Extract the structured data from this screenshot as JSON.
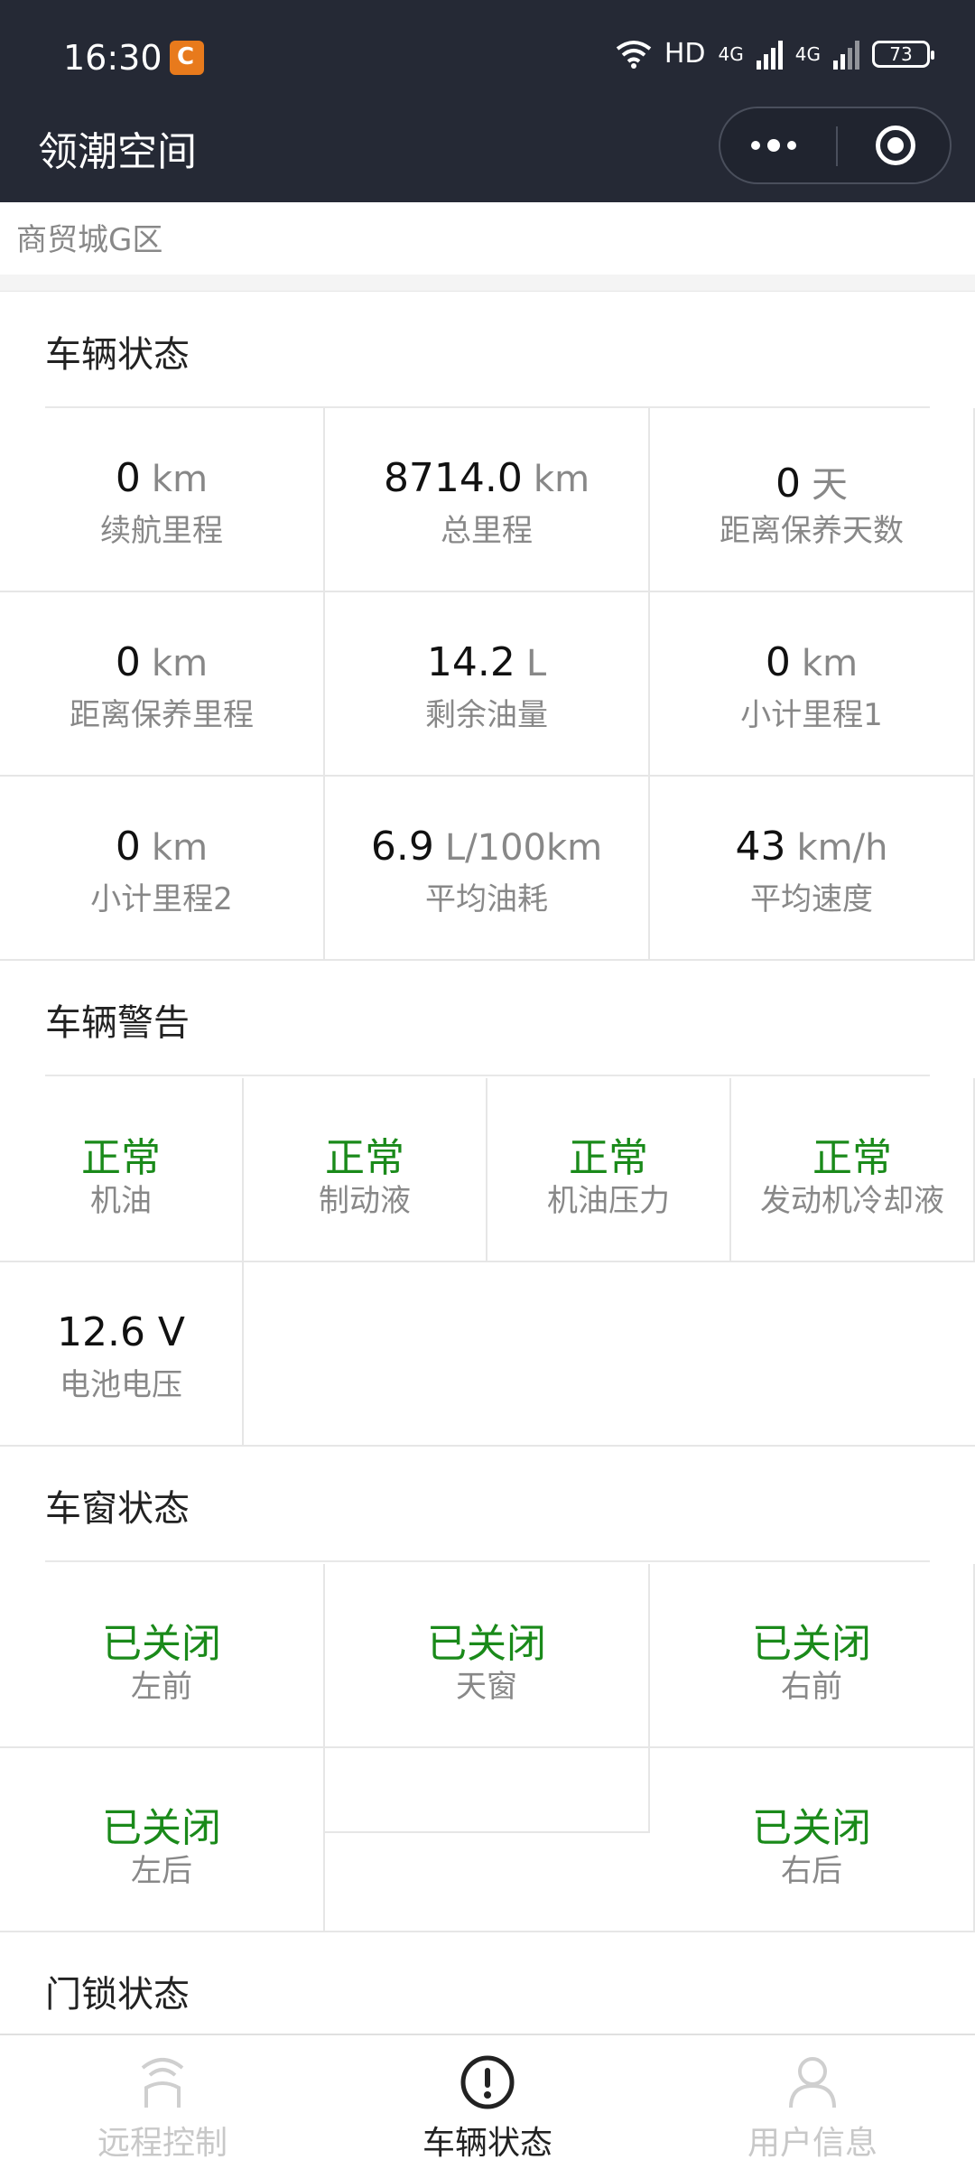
{
  "status_bar": {
    "time": "16:30",
    "network_label": "HD",
    "signal_1": "4G",
    "signal_2": "4G",
    "battery": "73"
  },
  "header": {
    "title": "领潮空间"
  },
  "address_tail": "商贸城G区",
  "vehicle_status": {
    "title": "车辆状态",
    "items": [
      {
        "value": "0",
        "unit": "km",
        "label": "续航里程"
      },
      {
        "value": "8714.0",
        "unit": "km",
        "label": "总里程"
      },
      {
        "value": "0",
        "unit": "天",
        "label": "距离保养天数"
      },
      {
        "value": "0",
        "unit": "km",
        "label": "距离保养里程"
      },
      {
        "value": "14.2",
        "unit": "L",
        "label": "剩余油量"
      },
      {
        "value": "0",
        "unit": "km",
        "label": "小计里程1"
      },
      {
        "value": "0",
        "unit": "km",
        "label": "小计里程2"
      },
      {
        "value": "6.9",
        "unit": "L/100km",
        "label": "平均油耗"
      },
      {
        "value": "43",
        "unit": "km/h",
        "label": "平均速度"
      }
    ]
  },
  "vehicle_warnings": {
    "title": "车辆警告",
    "items": [
      {
        "value": "正常",
        "label": "机油"
      },
      {
        "value": "正常",
        "label": "制动液"
      },
      {
        "value": "正常",
        "label": "机油压力"
      },
      {
        "value": "正常",
        "label": "发动机冷却液"
      },
      {
        "value": "12.6 V",
        "label": "电池电压"
      }
    ]
  },
  "window_status": {
    "title": "车窗状态",
    "items": [
      {
        "value": "已关闭",
        "label": "左前"
      },
      {
        "value": "已关闭",
        "label": "天窗"
      },
      {
        "value": "已关闭",
        "label": "右前"
      },
      {
        "value": "已关闭",
        "label": "左后"
      },
      {
        "value": "已关闭",
        "label": "右后"
      }
    ]
  },
  "door_lock_status": {
    "title": "门锁状态"
  },
  "tabbar": {
    "tabs": [
      {
        "label": "远程控制",
        "icon": "remote-signal-icon"
      },
      {
        "label": "车辆状态",
        "icon": "alert-circle-icon"
      },
      {
        "label": "用户信息",
        "icon": "user-icon"
      }
    ],
    "active": "车辆状态"
  },
  "colors": {
    "header_bg": "#252935",
    "ok_green": "#1a8a1a",
    "muted": "#888888"
  }
}
